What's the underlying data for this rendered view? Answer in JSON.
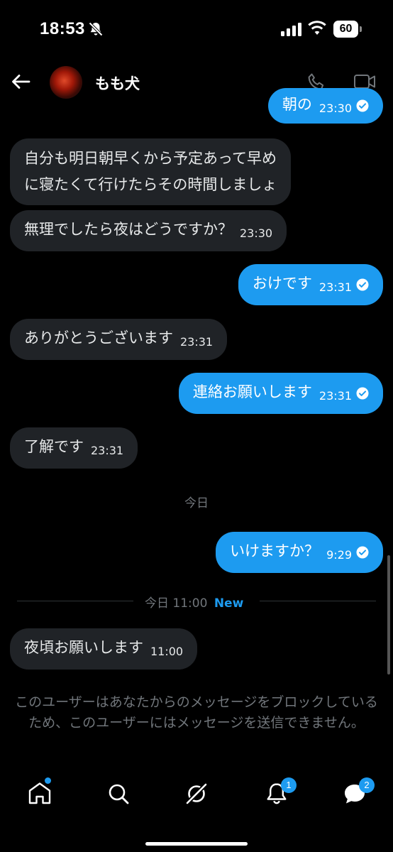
{
  "status_bar": {
    "time": "18:53",
    "battery": "60"
  },
  "header": {
    "contact_name": "もも犬"
  },
  "messages": [
    {
      "dir": "out",
      "text": "朝の",
      "time": "23:30",
      "read": true
    },
    {
      "dir": "in",
      "text_lines": [
        "自分も明日朝早くから予定あって早め",
        "に寝たくて行けたらその時間しましょ"
      ]
    },
    {
      "dir": "in",
      "text": "無理でしたら夜はどうですか？",
      "time": "23:30"
    },
    {
      "dir": "out",
      "text": "おけです",
      "time": "23:31",
      "read": true
    },
    {
      "dir": "in",
      "text": "ありがとうございます",
      "time": "23:31"
    },
    {
      "dir": "out",
      "text": "連絡お願いします",
      "time": "23:31",
      "read": true
    },
    {
      "dir": "in",
      "text": "了解です",
      "time": "23:31"
    },
    {
      "dir": "out",
      "text": "いけますか？",
      "time": "9:29",
      "read": true
    },
    {
      "dir": "in",
      "text": "夜頃お願いします",
      "time": "11:00"
    }
  ],
  "dividers": {
    "today": "今日",
    "new_marker_time": "今日 11:00",
    "new_label": "New"
  },
  "blocked_notice": "このユーザーはあなたからのメッセージをブロックしているため、このユーザーにはメッセージを送信できません。",
  "tabbar": {
    "items": [
      {
        "name": "home",
        "icon": "home-icon",
        "dot": true
      },
      {
        "name": "search",
        "icon": "search-icon"
      },
      {
        "name": "grok",
        "icon": "grok-icon"
      },
      {
        "name": "notifications",
        "icon": "bell-icon",
        "badge": "1"
      },
      {
        "name": "messages",
        "icon": "messages-icon",
        "badge": "2"
      }
    ]
  },
  "colors": {
    "accent": "#1d9bf0",
    "incoming_bubble": "#202327",
    "background": "#000000",
    "muted": "#71767b"
  }
}
